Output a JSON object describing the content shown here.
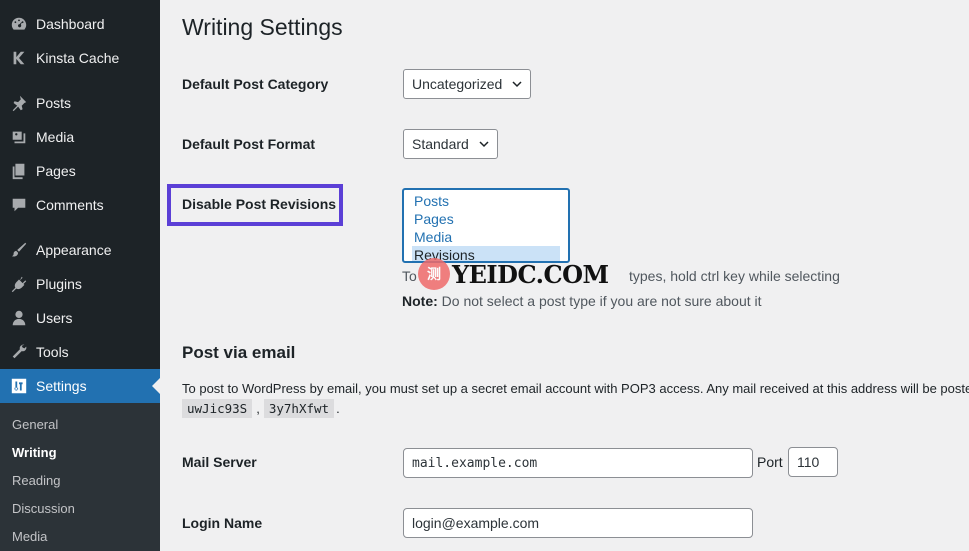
{
  "sidebar": {
    "items": [
      {
        "label": "Dashboard",
        "icon": "dashboard-icon"
      },
      {
        "label": "Kinsta Cache",
        "icon": "kinsta-k-icon"
      },
      {
        "label": "Posts",
        "icon": "pin-icon"
      },
      {
        "label": "Media",
        "icon": "media-icon"
      },
      {
        "label": "Pages",
        "icon": "pages-icon"
      },
      {
        "label": "Comments",
        "icon": "comment-icon"
      },
      {
        "label": "Appearance",
        "icon": "brush-icon"
      },
      {
        "label": "Plugins",
        "icon": "plugin-icon"
      },
      {
        "label": "Users",
        "icon": "user-icon"
      },
      {
        "label": "Tools",
        "icon": "wrench-icon"
      },
      {
        "label": "Settings",
        "icon": "settings-sliders-icon",
        "current": true
      }
    ],
    "submenu": [
      "General",
      "Writing",
      "Reading",
      "Discussion",
      "Media"
    ],
    "submenu_current": "Writing"
  },
  "main": {
    "title": "Writing Settings",
    "default_category": {
      "label": "Default Post Category",
      "value": "Uncategorized"
    },
    "default_format": {
      "label": "Default Post Format",
      "value": "Standard"
    },
    "disable_revisions": {
      "label": "Disable Post Revisions",
      "options": [
        "Posts",
        "Pages",
        "Media",
        "Revisions"
      ],
      "selected": "Revisions",
      "help_prefix": "To",
      "help_suffix": "types, hold ctrl key while selecting",
      "note_label": "Note:",
      "note_text": "Do not select a post type if you are not sure about it"
    },
    "watermark": {
      "glyph": "测",
      "text": "YEIDC.COM"
    },
    "post_via_email": {
      "title": "Post via email",
      "description": "To post to WordPress by email, you must set up a secret email account with POP3 access. Any mail received at this address will be posted, s",
      "code1": "uwJic93S",
      "code2": "3y7hXfwt",
      "separator": ",",
      "end": "."
    },
    "mail_server": {
      "label": "Mail Server",
      "value": "mail.example.com",
      "port_label": "Port",
      "port_value": "110"
    },
    "login_name": {
      "label": "Login Name",
      "value": "login@example.com"
    }
  },
  "colors": {
    "sidebar_bg": "#1d2327",
    "accent": "#2271b1",
    "highlight": "#5b3fd6"
  }
}
